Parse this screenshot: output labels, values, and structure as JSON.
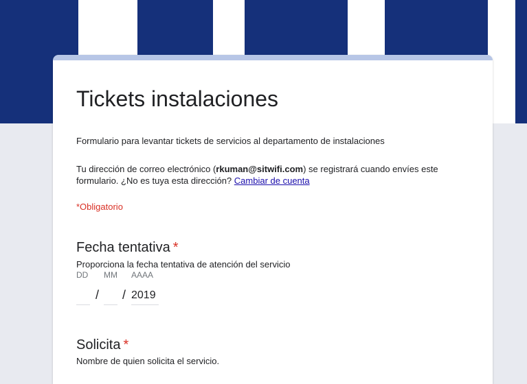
{
  "form": {
    "title": "Tickets instalaciones",
    "description": "Formulario para  levantar tickets de servicios al departamento de instalaciones",
    "account_prefix": "Tu dirección de correo electrónico (",
    "account_email": "rkuman@sitwifi.com",
    "account_suffix": ") se registrará cuando envíes este formulario. ¿No es tuya esta dirección? ",
    "switch_account": "Cambiar de cuenta",
    "required_note": "*Obligatorio"
  },
  "questions": {
    "date": {
      "title": "Fecha tentativa",
      "required_mark": "*",
      "help": "Proporciona la fecha tentativa de atención del servicio",
      "labels": {
        "day": "DD",
        "month": "MM",
        "year": "AAAA"
      },
      "separator": "/",
      "values": {
        "day": "",
        "month": "",
        "year": "2019"
      }
    },
    "requester": {
      "title": "Solicita",
      "required_mark": "*",
      "help": "Nombre de quien solicita el servicio."
    }
  },
  "colors": {
    "banner_blue": "#15307a",
    "accent": "#b7c6e6",
    "required": "#d93025",
    "link": "#1a0dab"
  }
}
